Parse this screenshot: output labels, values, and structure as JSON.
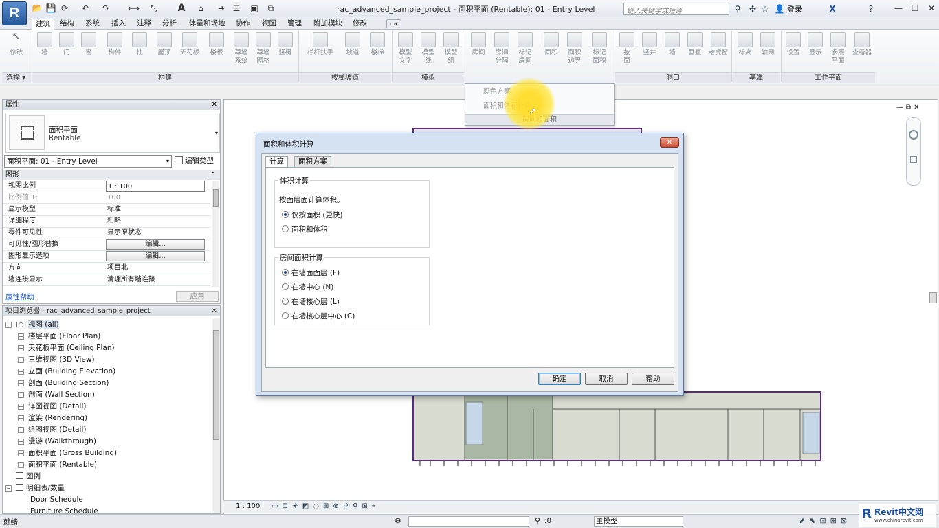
{
  "titlebar": {
    "title": "rac_advanced_sample_project - 面积平面 (Rentable): 01 - Entry Level",
    "search_placeholder": "键入关键字或短语",
    "login": "登录",
    "app_button": "R"
  },
  "tabs": [
    "建筑",
    "结构",
    "系统",
    "插入",
    "注释",
    "分析",
    "体量和场地",
    "协作",
    "视图",
    "管理",
    "附加模块",
    "修改"
  ],
  "ribbon": {
    "select_label": "选择",
    "modify": "修改",
    "build_buttons": [
      "墙",
      "门",
      "窗",
      "构件",
      "柱",
      "屋顶",
      "天花板",
      "楼板",
      "幕墙\n系统",
      "幕墙\n网格",
      "竖梃"
    ],
    "build_panel": "构建",
    "circ_buttons": [
      "栏杆扶手",
      "坡道",
      "楼梯"
    ],
    "circ_panel": "楼梯坡道",
    "model_buttons": [
      "模型\n文字",
      "模型\n线",
      "模型\n组"
    ],
    "model_panel": "模型",
    "room_buttons": [
      "房间",
      "房间\n分隔",
      "标记\n房间",
      "面积",
      "面积\n边界",
      "标记\n面积"
    ],
    "opening_buttons": [
      "按\n面",
      "竖井",
      "墙",
      "垂直",
      "老虎窗"
    ],
    "opening_panel": "洞口",
    "datum_buttons": [
      "标高",
      "轴网"
    ],
    "datum_panel": "基准",
    "work_buttons": [
      "设置",
      "显示",
      "参照\n平面",
      "查看器"
    ],
    "work_panel": "工作平面"
  },
  "dropdown": {
    "items": [
      "颜色方案",
      "面积和体积计算"
    ],
    "footer": "房间和面积"
  },
  "properties": {
    "header": "属性",
    "type_name": "面积平面",
    "type_sub": "Rentable",
    "selector": "面积平面: 01 - Entry Level",
    "edit_type": "编辑类型",
    "section": "图形",
    "rows": [
      {
        "k": "视图比例",
        "v": "1 : 100"
      },
      {
        "k": "比例值 1:",
        "v": "100"
      },
      {
        "k": "显示模型",
        "v": "标准"
      },
      {
        "k": "详细程度",
        "v": "粗略"
      },
      {
        "k": "零件可见性",
        "v": "显示原状态"
      },
      {
        "k": "可见性/图形替换",
        "v": "编辑..."
      },
      {
        "k": "图形显示选项",
        "v": "编辑..."
      },
      {
        "k": "方向",
        "v": "项目北"
      },
      {
        "k": "墙连接显示",
        "v": "清理所有墙连接"
      }
    ],
    "help_link": "属性帮助",
    "apply": "应用"
  },
  "browser": {
    "header": "项目浏览器 - rac_advanced_sample_project",
    "root": "视图 (all)",
    "nodes": [
      "楼层平面 (Floor Plan)",
      "天花板平面 (Ceiling Plan)",
      "三维视图 (3D View)",
      "立面 (Building Elevation)",
      "剖面 (Building Section)",
      "剖面 (Wall Section)",
      "详图视图 (Detail)",
      "渲染 (Rendering)",
      "绘图视图 (Detail)",
      "漫游 (Walkthrough)",
      "面积平面 (Gross Building)",
      "面积平面 (Rentable)"
    ],
    "legends": "图例",
    "schedules": "明细表/数量",
    "schedule_items": [
      "Door Schedule",
      "Furniture Schedule"
    ]
  },
  "dialog": {
    "title": "面积和体积计算",
    "tabs": [
      "计算",
      "面积方案"
    ],
    "volume_group": "体积计算",
    "volume_note": "按面层面计算体积。",
    "volume_options": [
      {
        "label": "仅按面积 (更快)",
        "checked": true
      },
      {
        "label": "面积和体积",
        "checked": false
      }
    ],
    "room_group": "房间面积计算",
    "room_options": [
      {
        "label": "在墙面面层 (F)",
        "checked": true
      },
      {
        "label": "在墙中心 (N)",
        "checked": false
      },
      {
        "label": "在墙核心层 (L)",
        "checked": false
      },
      {
        "label": "在墙核心层中心 (C)",
        "checked": false
      }
    ],
    "ok": "确定",
    "cancel": "取消",
    "help": "帮助"
  },
  "viewbar": {
    "scale": "1 : 100"
  },
  "statusbar": {
    "ready": "就绪",
    "count": ":0",
    "model": "主模型",
    "brand": "Revit中文网",
    "brand_url": "www.chinarevit.com"
  },
  "colors": {
    "accent": "#2a5ea8",
    "room_fill": "#d8dcd1",
    "wall": "#5a2b7a"
  }
}
